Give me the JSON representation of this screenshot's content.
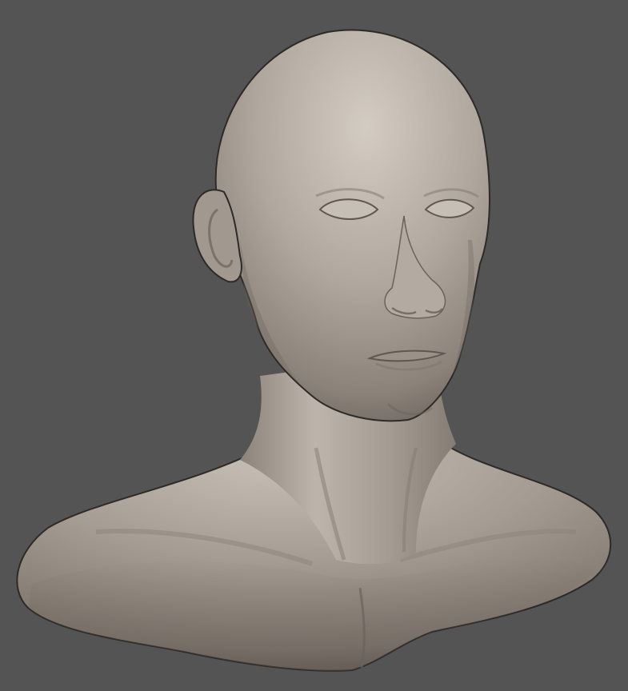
{
  "scene": {
    "background_color": "#545454",
    "object": "sculpted bust",
    "material": {
      "base_color": "#9d958b",
      "highlight_color": "#cfc8be",
      "shadow_color": "#5f5750",
      "outline_color": "#2e2a27"
    },
    "features": [
      "bald-head-icon",
      "ear-icon",
      "eye-icon",
      "nose-icon",
      "mouth-icon",
      "neck-icon",
      "shoulders-icon"
    ]
  }
}
